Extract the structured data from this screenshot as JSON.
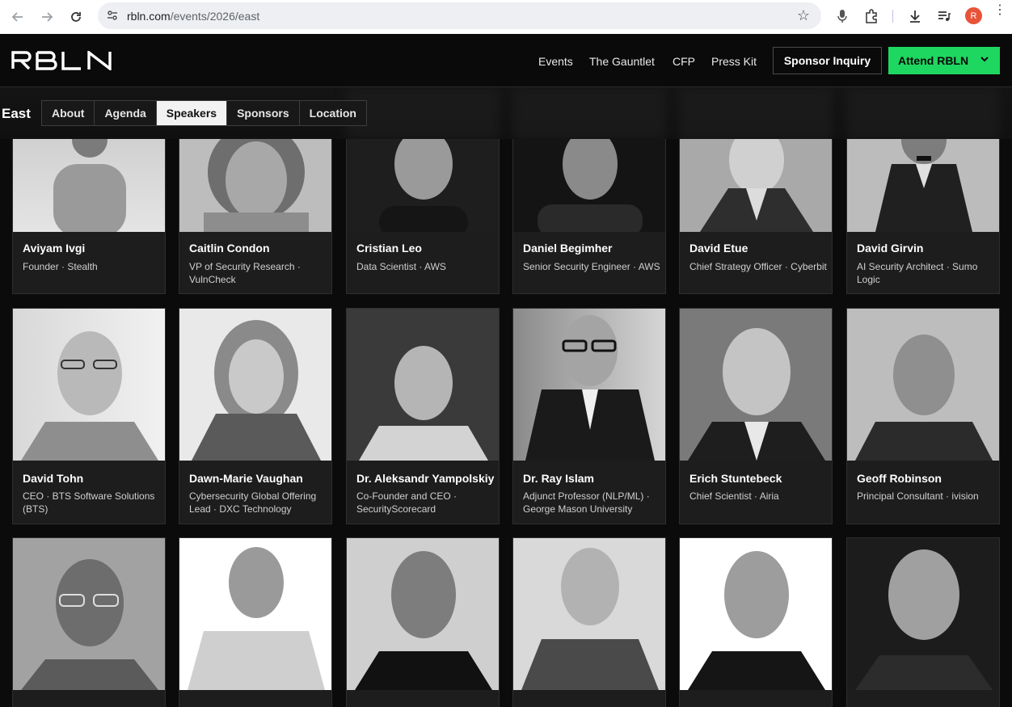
{
  "browser": {
    "url_host": "rbln.com",
    "url_path": "/events/2026/east",
    "profile_initial": "R"
  },
  "header": {
    "logo_text": "RBLN",
    "nav": [
      "Events",
      "The Gauntlet",
      "CFP",
      "Press Kit"
    ],
    "sponsor_button": "Sponsor Inquiry",
    "attend_button": "Attend RBLN"
  },
  "subnav": {
    "event_label": "East",
    "tabs": [
      "About",
      "Agenda",
      "Speakers",
      "Sponsors",
      "Location"
    ],
    "active_tab": "Speakers"
  },
  "speakers": [
    {
      "name": "Aviyam Ivgi",
      "role": "Founder · Stealth"
    },
    {
      "name": "Caitlin Condon",
      "role": "VP of Security Research · VulnCheck"
    },
    {
      "name": "Cristian Leo",
      "role": "Data Scientist · AWS"
    },
    {
      "name": "Daniel Begimher",
      "role": "Senior Security Engineer · AWS"
    },
    {
      "name": "David Etue",
      "role": "Chief Strategy Officer · Cyberbit"
    },
    {
      "name": "David Girvin",
      "role": "AI Security Architect · Sumo Logic"
    },
    {
      "name": "David Tohn",
      "role": "CEO · BTS Software Solutions (BTS)"
    },
    {
      "name": "Dawn-Marie Vaughan",
      "role": "Cybersecurity Global Offering Lead · DXC Technology"
    },
    {
      "name": "Dr. Aleksandr Yampolskiy",
      "role": "Co-Founder and CEO · SecurityScorecard"
    },
    {
      "name": "Dr. Ray Islam",
      "role": "Adjunct Professor (NLP/ML) · George Mason University"
    },
    {
      "name": "Erich Stuntebeck",
      "role": "Chief Scientist · Airia"
    },
    {
      "name": "Geoff Robinson",
      "role": "Principal Consultant · ivision"
    },
    {
      "name": "",
      "role": ""
    },
    {
      "name": "",
      "role": ""
    },
    {
      "name": "",
      "role": ""
    },
    {
      "name": "",
      "role": ""
    },
    {
      "name": "",
      "role": ""
    },
    {
      "name": "",
      "role": ""
    }
  ],
  "colors": {
    "accent": "#1ed760",
    "background": "#0b0b0b",
    "card": "#1d1d1d"
  }
}
